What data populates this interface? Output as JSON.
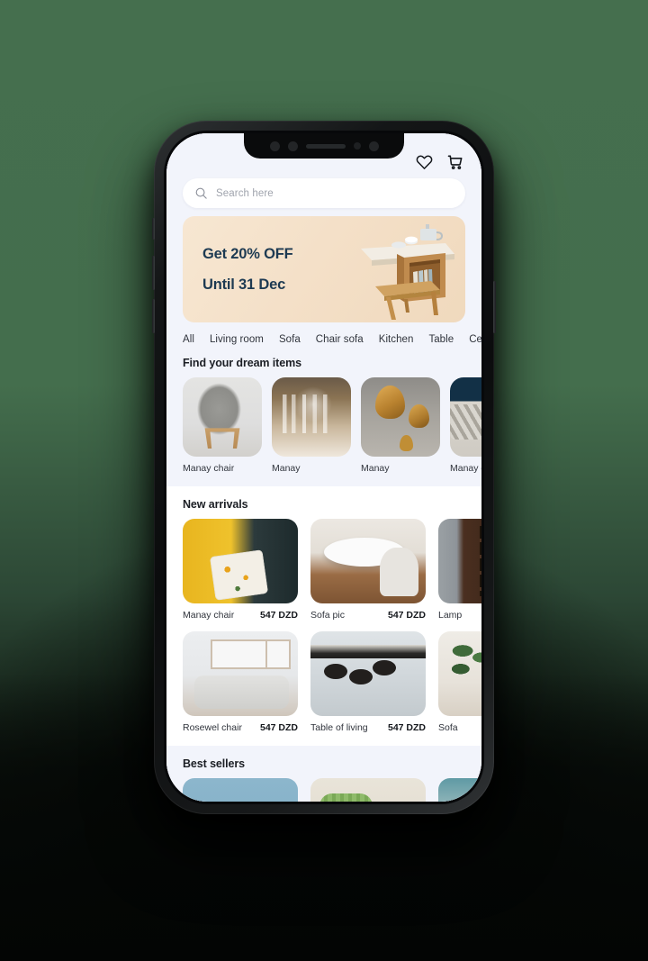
{
  "app": {
    "accent_banner_bg": "#f4e0c8",
    "banner_text_color": "#1d3a52",
    "screen_bg": "#f2f4fb",
    "scene_bg": "#456f4e"
  },
  "topbar": {
    "favorites_icon": "heart-icon",
    "cart_icon": "shopping-cart-icon"
  },
  "search": {
    "icon": "search-icon",
    "placeholder": "Search here",
    "value": ""
  },
  "banner": {
    "line1": "Get 20% OFF",
    "line2": "Until 31 Dec"
  },
  "categories": [
    {
      "label": "All",
      "selected": true
    },
    {
      "label": "Living room",
      "selected": false
    },
    {
      "label": "Sofa",
      "selected": false
    },
    {
      "label": "Chair sofa",
      "selected": false
    },
    {
      "label": "Kitchen",
      "selected": false
    },
    {
      "label": "Table",
      "selected": false
    },
    {
      "label": "Cera",
      "selected": false
    }
  ],
  "dream_section": {
    "title": "Find your dream items",
    "items": [
      {
        "label": "Manay chair",
        "image": "grey-wingback-chair"
      },
      {
        "label": "Manay",
        "image": "glassware-dinner-table"
      },
      {
        "label": "Manay",
        "image": "brass-pendant-lamps"
      },
      {
        "label": "Manay cha",
        "image": "striped-sofa-navy-wall"
      }
    ]
  },
  "new_arrivals": {
    "title": "New arrivals",
    "rows": [
      [
        {
          "name": "Manay chair",
          "price": "547 DZD",
          "image": "yellow-chair-lemon-pillow"
        },
        {
          "name": "Sofa pic",
          "price": "547 DZD",
          "image": "white-round-table"
        },
        {
          "name": "Lamp",
          "price": "",
          "image": "dark-wood-shelf"
        }
      ],
      [
        {
          "name": "Rosewel chair",
          "price": "547 DZD",
          "image": "grey-living-room"
        },
        {
          "name": "Table of living",
          "price": "547 DZD",
          "image": "bar-stools"
        },
        {
          "name": "Sofa",
          "price": "",
          "image": "plant-rattan-cabinet"
        }
      ]
    ]
  },
  "best_sellers": {
    "title": "Best sellers",
    "items": [
      {
        "image": "white-stool-blue-bg"
      },
      {
        "image": "green-chair"
      },
      {
        "image": "teal-room"
      }
    ]
  }
}
